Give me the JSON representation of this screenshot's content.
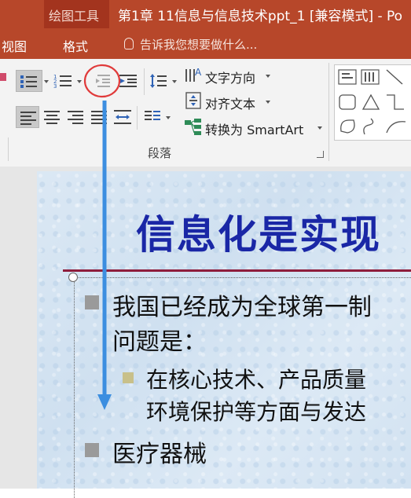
{
  "title_bar": {
    "context_tab_group": "绘图工具",
    "document_title": "第1章 11信息与信息技术ppt_1 [兼容模式] - Po"
  },
  "tabs": {
    "view": "视图",
    "format": "格式"
  },
  "tell_me": "告诉我您想要做什么...",
  "ribbon": {
    "text_direction": "文字方向",
    "align_text": "对齐文本",
    "convert_smartart": "转换为 SmartArt",
    "group_label": "段落"
  },
  "slide": {
    "title": "信息化是实现",
    "bullets": [
      {
        "line1": "我国已经成为全球第一制",
        "line2": "问题是："
      },
      {
        "line1": "在核心技术、产品质量",
        "line2": "环境保护等方面与发达"
      },
      {
        "line1": "医疗器械"
      }
    ]
  },
  "annotation": {
    "circle_color": "#e03a3a",
    "arrow_color": "#3c8ee0"
  },
  "colors": {
    "accent": "#b7472a",
    "title_blue": "#1a27a6",
    "rule": "#8e1d3c"
  }
}
